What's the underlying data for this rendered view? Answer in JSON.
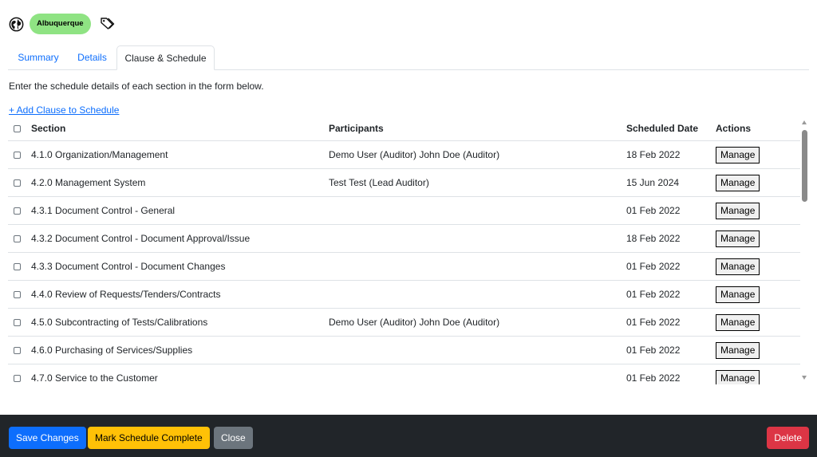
{
  "header": {
    "location_badge": "Albuquerque",
    "icons": [
      "globe-icon",
      "tags-icon"
    ]
  },
  "tabs": [
    {
      "label": "Summary",
      "active": false
    },
    {
      "label": "Details",
      "active": false
    },
    {
      "label": "Clause & Schedule",
      "active": true
    }
  ],
  "instructions": "Enter the schedule details of each section in the form below.",
  "add_clause_link": "+ Add Clause to Schedule",
  "table": {
    "columns": [
      "Section",
      "Participants",
      "Scheduled Date",
      "Actions"
    ],
    "rows": [
      {
        "section": "4.1.0 Organization/Management",
        "participants": "Demo User (Auditor) John Doe (Auditor)",
        "date": "18 Feb 2022",
        "action": "Manage"
      },
      {
        "section": "4.2.0 Management System",
        "participants": "Test Test (Lead Auditor)",
        "date": "15 Jun 2024",
        "action": "Manage"
      },
      {
        "section": "4.3.1 Document Control - General",
        "participants": "",
        "date": "01 Feb 2022",
        "action": "Manage"
      },
      {
        "section": "4.3.2 Document Control - Document Approval/Issue",
        "participants": "",
        "date": "18 Feb 2022",
        "action": "Manage"
      },
      {
        "section": "4.3.3 Document Control - Document Changes",
        "participants": "",
        "date": "01 Feb 2022",
        "action": "Manage"
      },
      {
        "section": "4.4.0 Review of Requests/Tenders/Contracts",
        "participants": "",
        "date": "01 Feb 2022",
        "action": "Manage"
      },
      {
        "section": "4.5.0 Subcontracting of Tests/Calibrations",
        "participants": "Demo User (Auditor) John Doe (Auditor)",
        "date": "01 Feb 2022",
        "action": "Manage"
      },
      {
        "section": "4.6.0 Purchasing of Services/Supplies",
        "participants": "",
        "date": "01 Feb 2022",
        "action": "Manage"
      },
      {
        "section": "4.7.0 Service to the Customer",
        "participants": "",
        "date": "01 Feb 2022",
        "action": "Manage"
      }
    ]
  },
  "footer": {
    "save_label": "Save Changes",
    "complete_label": "Mark Schedule Complete",
    "close_label": "Close",
    "delete_label": "Delete"
  },
  "colors": {
    "primary": "#0d6efd",
    "warning": "#ffc107",
    "secondary": "#6c757d",
    "danger": "#dc3545",
    "badge": "#8fe383",
    "footer_bg": "#212529"
  }
}
